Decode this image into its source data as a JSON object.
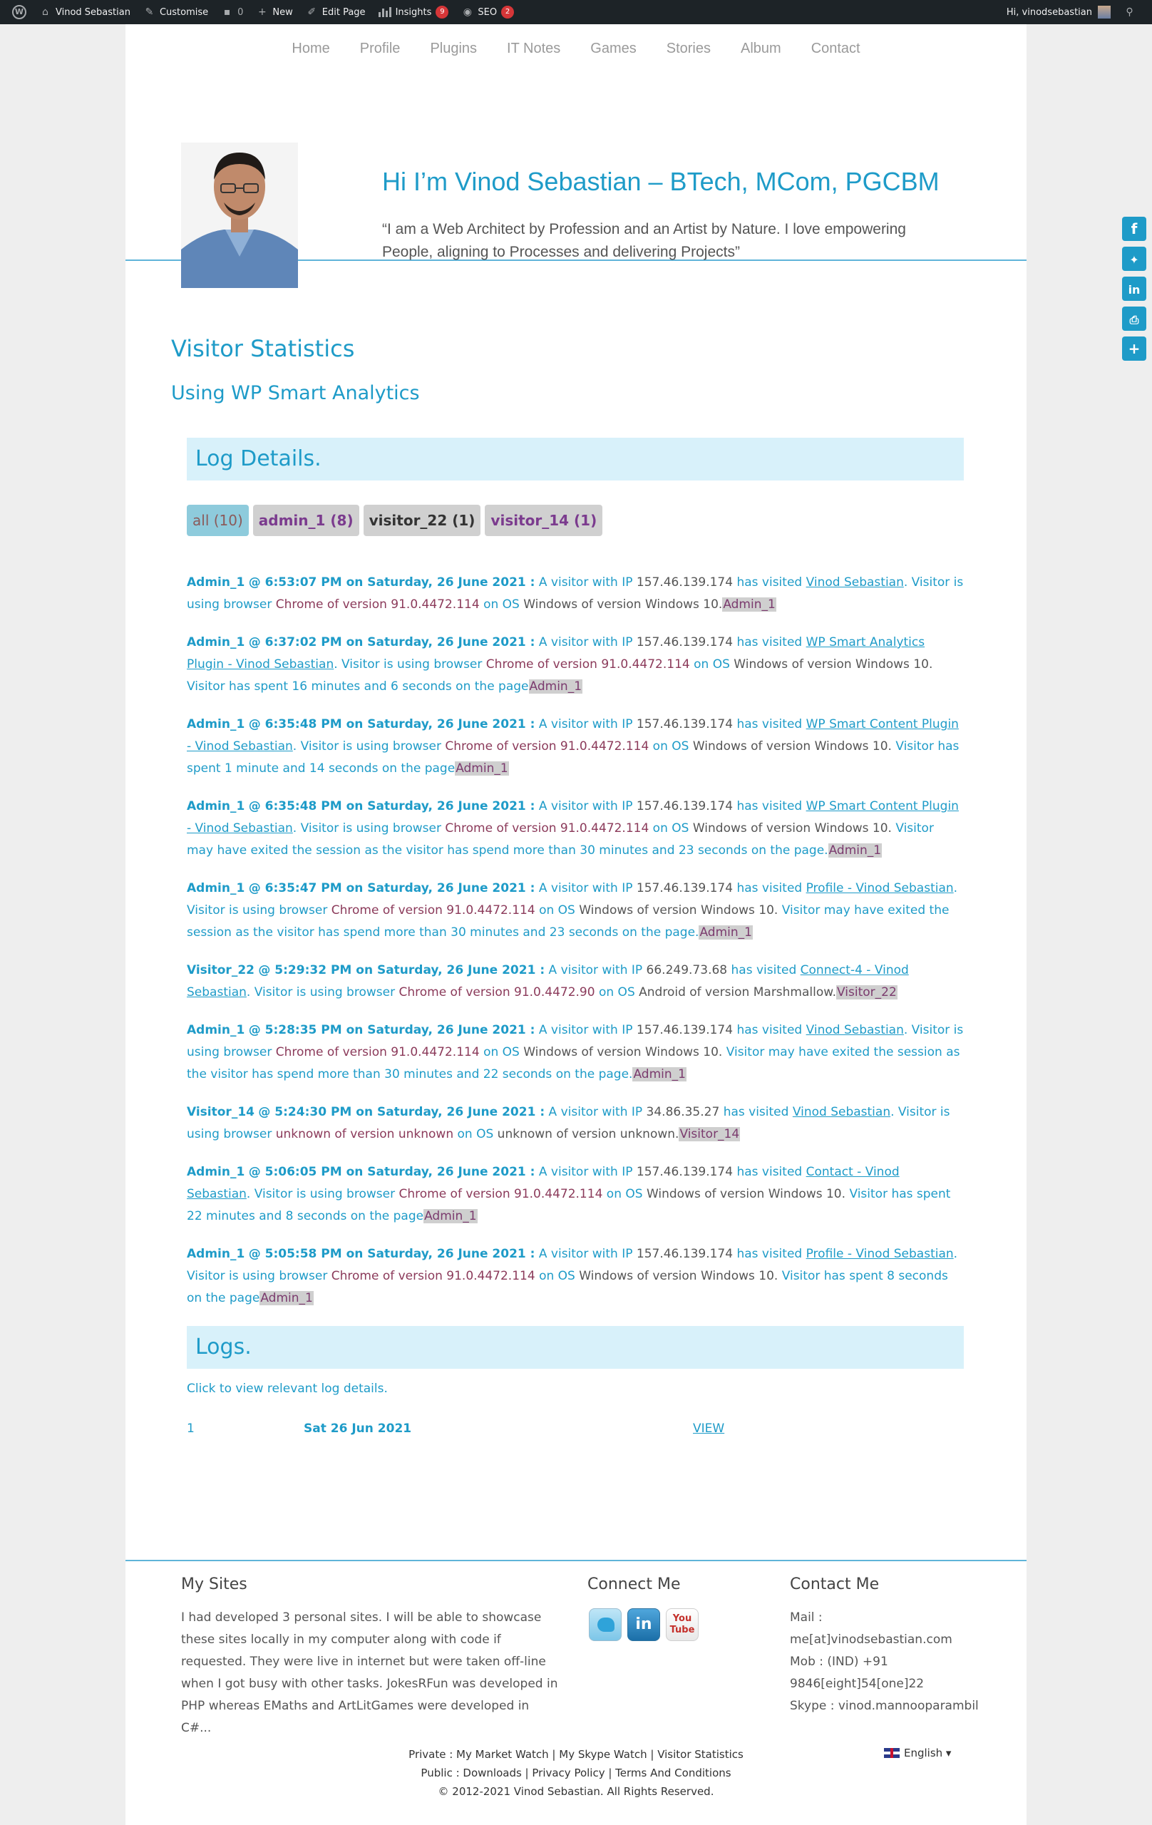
{
  "admin_bar": {
    "site_name": "Vinod Sebastian",
    "customise": "Customise",
    "comments_count": "0",
    "new": "New",
    "edit_page": "Edit Page",
    "insights": "Insights",
    "insights_badge": "9",
    "seo": "SEO",
    "seo_badge": "2",
    "greeting": "Hi, vinodsebastian"
  },
  "nav": {
    "items": [
      "Home",
      "Profile",
      "Plugins",
      "IT Notes",
      "Games",
      "Stories",
      "Album",
      "Contact"
    ]
  },
  "hero": {
    "title": "Hi I’m Vinod Sebastian – BTech, MCom, PGCBM",
    "tagline": "“I am a Web Architect by Profession and an Artist by Nature. I love empowering People, aligning to Processes and delivering Projects”"
  },
  "content": {
    "heading": "Visitor Statistics",
    "subheading": "Using WP Smart Analytics",
    "log_details_title": "Log Details.",
    "filters": [
      "all (10)",
      "admin_1 (8)",
      "visitor_22 (1)",
      "visitor_14 (1)"
    ],
    "logs": [
      {
        "who": "Admin_1",
        "when": "@ 6:53:07 PM on Saturday, 26 June 2021 :",
        "ip": "157.46.139.174",
        "page": "Vinod Sebastian",
        "browser": "Chrome of version 91.0.4472.114",
        "os": "Windows of version Windows 10.",
        "extra": "",
        "tag": "Admin_1"
      },
      {
        "who": "Admin_1",
        "when": "@ 6:37:02 PM on Saturday, 26 June 2021 :",
        "ip": "157.46.139.174",
        "page": "WP Smart Analytics Plugin - Vinod Sebastian",
        "browser": "Chrome of version 91.0.4472.114",
        "os": "Windows of version Windows 10.",
        "extra": "Visitor has spent 16 minutes and 6 seconds on the page",
        "tag": "Admin_1"
      },
      {
        "who": "Admin_1",
        "when": "@ 6:35:48 PM on Saturday, 26 June 2021 :",
        "ip": "157.46.139.174",
        "page": "WP Smart Content Plugin - Vinod Sebastian",
        "browser": "Chrome of version 91.0.4472.114",
        "os": "Windows of version Windows 10.",
        "extra": "Visitor has spent 1 minute and 14 seconds on the page",
        "tag": "Admin_1"
      },
      {
        "who": "Admin_1",
        "when": "@ 6:35:48 PM on Saturday, 26 June 2021 :",
        "ip": "157.46.139.174",
        "page": "WP Smart Content Plugin - Vinod Sebastian",
        "browser": "Chrome of version 91.0.4472.114",
        "os": "Windows of version Windows 10.",
        "extra": "Visitor may have exited the session as the visitor has spend more than 30 minutes and 23 seconds on the page.",
        "tag": "Admin_1"
      },
      {
        "who": "Admin_1",
        "when": "@ 6:35:47 PM on Saturday, 26 June 2021 :",
        "ip": "157.46.139.174",
        "page": "Profile - Vinod Sebastian",
        "browser": "Chrome of version 91.0.4472.114",
        "os": "Windows of version Windows 10.",
        "extra": "Visitor may have exited the session as the visitor has spend more than 30 minutes and 23 seconds on the page.",
        "tag": "Admin_1"
      },
      {
        "who": "Visitor_22",
        "when": "@ 5:29:32 PM on Saturday, 26 June 2021 :",
        "ip": "66.249.73.68",
        "page": "Connect-4 - Vinod Sebastian",
        "browser": "Chrome of version 91.0.4472.90",
        "os": "Android of version Marshmallow.",
        "extra": "",
        "tag": "Visitor_22"
      },
      {
        "who": "Admin_1",
        "when": "@ 5:28:35 PM on Saturday, 26 June 2021 :",
        "ip": "157.46.139.174",
        "page": "Vinod Sebastian",
        "browser": "Chrome of version 91.0.4472.114",
        "os": "Windows of version Windows 10.",
        "extra": "Visitor may have exited the session as the visitor has spend more than 30 minutes and 22 seconds on the page.",
        "tag": "Admin_1"
      },
      {
        "who": "Visitor_14",
        "when": "@ 5:24:30 PM on Saturday, 26 June 2021 :",
        "ip": "34.86.35.27",
        "page": "Vinod Sebastian",
        "browser": "unknown of version unknown",
        "os": "unknown of version unknown.",
        "extra": "",
        "tag": "Visitor_14"
      },
      {
        "who": "Admin_1",
        "when": "@ 5:06:05 PM on Saturday, 26 June 2021 :",
        "ip": "157.46.139.174",
        "page": "Contact - Vinod Sebastian",
        "browser": "Chrome of version 91.0.4472.114",
        "os": "Windows of version Windows 10.",
        "extra": "Visitor has spent 22 minutes and 8 seconds on the page",
        "tag": "Admin_1"
      },
      {
        "who": "Admin_1",
        "when": "@ 5:05:58 PM on Saturday, 26 June 2021 :",
        "ip": "157.46.139.174",
        "page": "Profile - Vinod Sebastian",
        "browser": "Chrome of version 91.0.4472.114",
        "os": "Windows of version Windows 10.",
        "extra": "Visitor has spent 8 seconds on the page",
        "tag": "Admin_1"
      }
    ],
    "logs_title": "Logs.",
    "logs_note": "Click to view relevant log details.",
    "logs_rows": [
      {
        "num": "1",
        "date": "Sat 26 Jun 2021",
        "action": "VIEW"
      }
    ]
  },
  "footer": {
    "my_sites_title": "My Sites",
    "my_sites_text": "I had developed 3 personal sites. I will be able to showcase these sites locally in my computer along with code if requested. They were live in internet but were taken off-line when I got busy with other tasks. JokesRFun was developed in PHP whereas EMaths and ArtLitGames were developed in C#...",
    "connect_title": "Connect Me",
    "contact_title": "Contact Me",
    "contact_lines": [
      "Mail :",
      "me[at]vinodsebastian.com",
      "Mob : (IND) +91",
      "9846[eight]54[one]22",
      "Skype : vinod.mannooparambil"
    ],
    "private_line": "Private : My Market Watch | My Skype Watch | Visitor Statistics",
    "public_line": "Public : Downloads | Privacy Policy | Terms And Conditions",
    "copyright": "© 2012-2021 Vinod Sebastian. All Rights Reserved.",
    "language": "English ▾",
    "youtube_label": "You Tube"
  },
  "share": {
    "icons": [
      "facebook-icon",
      "twitter-icon",
      "linkedin-icon",
      "print-icon",
      "share-plus-icon"
    ]
  },
  "colors": {
    "accent": "#1e9bc8",
    "admin_bar": "#1d2327",
    "box_bg": "#d8f1fa",
    "badge": "#d63638"
  }
}
